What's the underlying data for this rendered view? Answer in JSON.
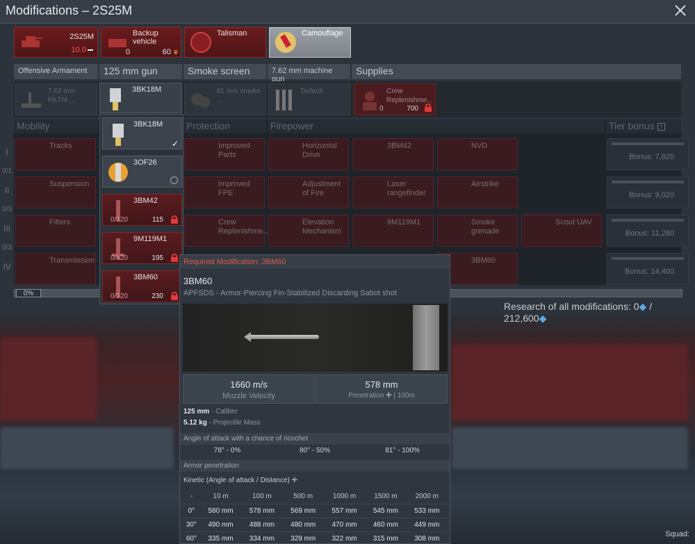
{
  "window": {
    "title": "Modifications – 2S25M"
  },
  "top_cards": [
    {
      "label": "2S25M",
      "sub": "10.0"
    },
    {
      "label": "Backup vehicle",
      "count": "0",
      "price": "60"
    },
    {
      "label": "Talisman"
    },
    {
      "label": "Camouflage"
    }
  ],
  "categories": {
    "offensive": "Offensive Armament",
    "gun": "125 mm gun",
    "smoke": "Smoke screen",
    "mg": "7.62 mm machine gun",
    "supplies": "Supplies"
  },
  "slots": {
    "pktm": "7.62 mm PKTM ...",
    "smoke": "81 mm smoke ...",
    "selected_shell": "3BK18M",
    "mg_default": "Default",
    "crew": "Crew Replenishme...",
    "crew_count": "0",
    "crew_price": "700"
  },
  "sections": {
    "mobility": "Mobility",
    "protection": "Protection",
    "firepower": "Firepower",
    "tier_bonus": "Tier bonus"
  },
  "tiers": [
    "I",
    "II",
    "III",
    "IV"
  ],
  "tier_counts": [
    "0/1",
    "0/3",
    "0/3"
  ],
  "mods": {
    "tracks": "Tracks",
    "suspension": "Suspension",
    "filters": "Filters",
    "transmission": "Transmission",
    "improved_parts": "Improved Parts",
    "improved_fpe": "Improved FPE",
    "crew_repl": "Crew Replenishme...",
    "horizontal_drive": "Horizontal Drive",
    "adj_fire": "Adjustment of Fire",
    "elevation": "Elevation Mechanism",
    "3bm42": "3BM42",
    "laser": "Laser rangefinder",
    "9m119m1": "9M119M1",
    "nvd": "NVD",
    "airstrike": "Airstrike",
    "smoke_grenade": "Smoke grenade",
    "scout_uav": "Scout UAV",
    "3bm60": "3BM60"
  },
  "bonuses": [
    "Bonus: 7,820",
    "Bonus: 9,020",
    "Bonus: 11,280",
    "Bonus: 14,400"
  ],
  "progress": {
    "percent": "0%",
    "value": 0
  },
  "research": {
    "label": "Research of all modifications: 0",
    "total": "/ 212,600"
  },
  "dropdown": [
    {
      "name": "3BK18M",
      "state": "selected"
    },
    {
      "name": "3OF26",
      "state": "available"
    },
    {
      "name": "3BM42",
      "progress": "0/120",
      "price": "115"
    },
    {
      "name": "9M119M1",
      "progress": "0/120",
      "price": "195"
    },
    {
      "name": "3BM60",
      "progress": "0/120",
      "price": "230"
    }
  ],
  "tooltip": {
    "required": "Required Modification: 3BM60",
    "name": "3BM60",
    "desc": "APFSDS - Armor-Piercing Fin-Stabilized Discarding Sabot shot",
    "muzzle_velocity": "1660 m/s",
    "muzzle_label": "Muzzle Velocity",
    "penetration": "578 mm",
    "penetration_label": "Penetration",
    "penetration_dist": "| 100m",
    "caliber": "125 mm",
    "caliber_label": "- Caliber",
    "mass": "5.12 kg",
    "mass_label": "- Projectile Mass",
    "ricochet_title": "Angle of attack with a chance of ricochet",
    "ricochet": [
      "78° - 0%",
      "80° - 50%",
      "81° - 100%"
    ],
    "armor_title": "Armor penetration",
    "kinetic_title": "Kinetic (Angle of attack / Distance)",
    "pen_table": [
      [
        "-",
        "10 m",
        "100 m",
        "500 m",
        "1000 m",
        "1500 m",
        "2000 m"
      ],
      [
        "0°",
        "580 mm",
        "578 mm",
        "569 mm",
        "557 mm",
        "545 mm",
        "533 mm"
      ],
      [
        "30°",
        "490 mm",
        "488 mm",
        "480 mm",
        "470 mm",
        "460 mm",
        "449 mm"
      ],
      [
        "60°",
        "335 mm",
        "334 mm",
        "329 mm",
        "322 mm",
        "315 mm",
        "308 mm"
      ]
    ]
  },
  "squad": "Squad:"
}
